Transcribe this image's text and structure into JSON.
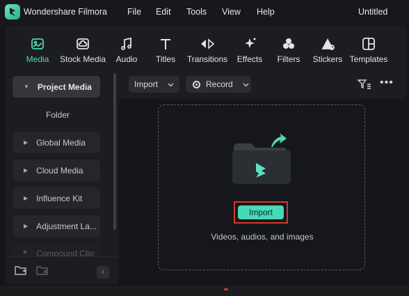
{
  "app": {
    "title": "Wondershare Filmora",
    "document_title": "Untitled"
  },
  "menu": [
    "File",
    "Edit",
    "Tools",
    "View",
    "Help"
  ],
  "toolbar": {
    "items": [
      {
        "label": "Media",
        "icon": "media-icon",
        "active": true
      },
      {
        "label": "Stock Media",
        "icon": "cloud-icon",
        "active": false
      },
      {
        "label": "Audio",
        "icon": "music-note-icon",
        "active": false
      },
      {
        "label": "Titles",
        "icon": "text-icon",
        "active": false
      },
      {
        "label": "Transitions",
        "icon": "transition-icon",
        "active": false
      },
      {
        "label": "Effects",
        "icon": "sparkle-icon",
        "active": false
      },
      {
        "label": "Filters",
        "icon": "filters-icon",
        "active": false
      },
      {
        "label": "Stickers",
        "icon": "sticker-icon",
        "active": false
      },
      {
        "label": "Templates",
        "icon": "templates-icon",
        "active": false
      }
    ]
  },
  "sidebar": {
    "items": [
      {
        "label": "Project Media",
        "active": true
      },
      {
        "label": "Folder"
      },
      {
        "label": "Global Media"
      },
      {
        "label": "Cloud Media"
      },
      {
        "label": "Influence Kit"
      },
      {
        "label": "Adjustment La..."
      },
      {
        "label": "Compound Clip"
      }
    ]
  },
  "content_bar": {
    "import_label": "Import",
    "record_label": "Record"
  },
  "dropzone": {
    "button_label": "Import",
    "hint": "Videos, audios, and images"
  },
  "colors": {
    "accent": "#47d8b5",
    "highlight": "#d5372c",
    "background": "#151619"
  }
}
